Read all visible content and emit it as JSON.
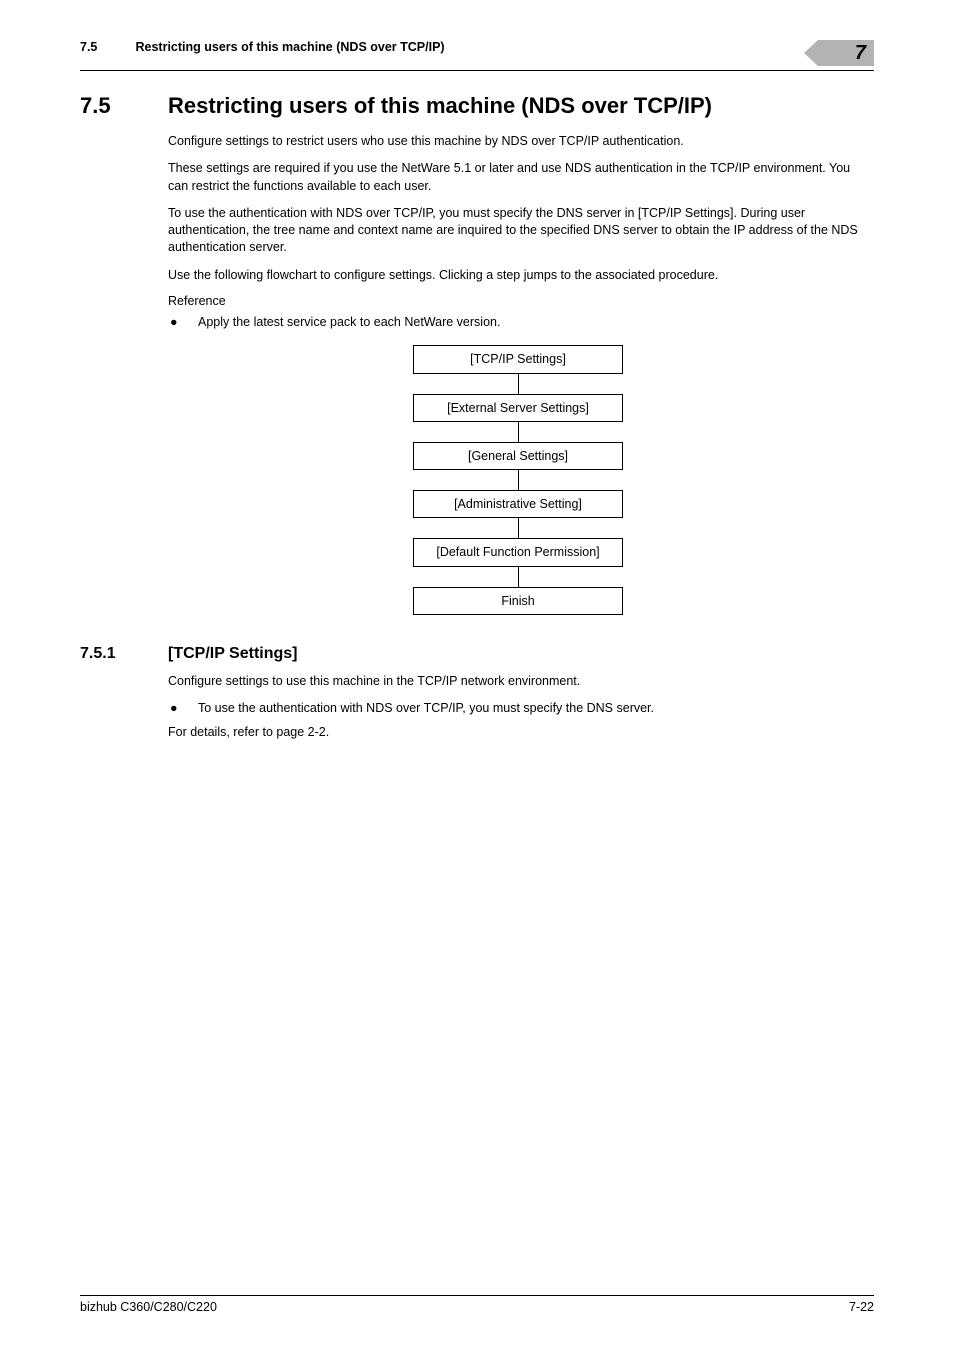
{
  "chapter_flag": "7",
  "header": {
    "section_num": "7.5",
    "section_title": "Restricting users of this machine (NDS over TCP/IP)"
  },
  "h1": {
    "num": "7.5",
    "title": "Restricting users of this machine (NDS over TCP/IP)"
  },
  "p1": "Configure settings to restrict users who use this machine by NDS over TCP/IP authentication.",
  "p2": "These settings are required if you use the NetWare 5.1 or later and use NDS authentication in the TCP/IP environment. You can restrict the functions available to each user.",
  "p3": "To use the authentication with NDS over TCP/IP, you must specify the DNS server in [TCP/IP Settings]. During user authentication, the tree name and context name are inquired to the specified DNS server to obtain the IP address of the NDS authentication server.",
  "p4": "Use the following flowchart to configure settings. Clicking a step jumps to the associated procedure.",
  "reference_label": "Reference",
  "bullet1": "Apply the latest service pack to each NetWare version.",
  "flow": {
    "b1": "[TCP/IP Settings]",
    "b2": "[External Server Settings]",
    "b3": "[General Settings]",
    "b4": "[Administrative Setting]",
    "b5": "[Default Function Permission]",
    "b6": "Finish"
  },
  "h2": {
    "num": "7.5.1",
    "title": "[TCP/IP Settings]"
  },
  "s2_p1": "Configure settings to use this machine in the TCP/IP network environment.",
  "s2_bullet1": "To use the authentication with NDS over TCP/IP, you must specify the DNS server.",
  "s2_p2": "For details, refer to page 2-2.",
  "footer": {
    "left": "bizhub C360/C280/C220",
    "right": "7-22"
  }
}
